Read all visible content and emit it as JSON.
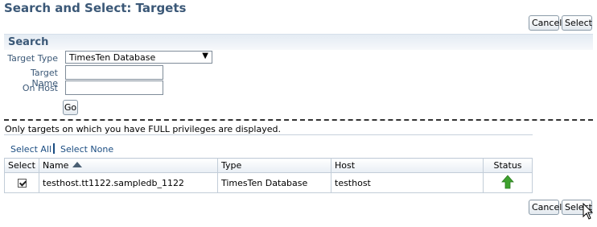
{
  "page": {
    "title": "Search and Select: Targets"
  },
  "top_actions": {
    "cancel_label": "Cancel",
    "select_label": "Select"
  },
  "search": {
    "section_title": "Search",
    "target_type_label": "Target Type",
    "target_type_value": "TimesTen Database",
    "target_name_label": "Target Name",
    "target_name_value": "",
    "on_host_label": "On Host",
    "on_host_value": "",
    "go_label": "Go"
  },
  "info_text": "Only targets on which you have FULL privileges are displayed.",
  "selection_links": {
    "select_all": "Select All",
    "select_none": "Select None"
  },
  "table": {
    "headers": {
      "select": "Select",
      "name": "Name",
      "type": "Type",
      "host": "Host",
      "status": "Status"
    },
    "sort": {
      "column": "Name",
      "direction": "ascending",
      "icon": "sort-ascending-icon"
    },
    "rows": [
      {
        "selected": true,
        "name": "testhost.tt1122.sampledb_1122",
        "type": "TimesTen Database",
        "host": "testhost",
        "status": "up",
        "status_icon": "status-up-arrow-icon",
        "status_color": "#3ea12e"
      }
    ]
  },
  "bottom_actions": {
    "cancel_label": "Cancel",
    "select_label": "Select"
  },
  "colors": {
    "title": "#3b5877",
    "link": "#1b4d82",
    "header_band": "#e4ebf3",
    "button_border": "#8a9aa8"
  }
}
